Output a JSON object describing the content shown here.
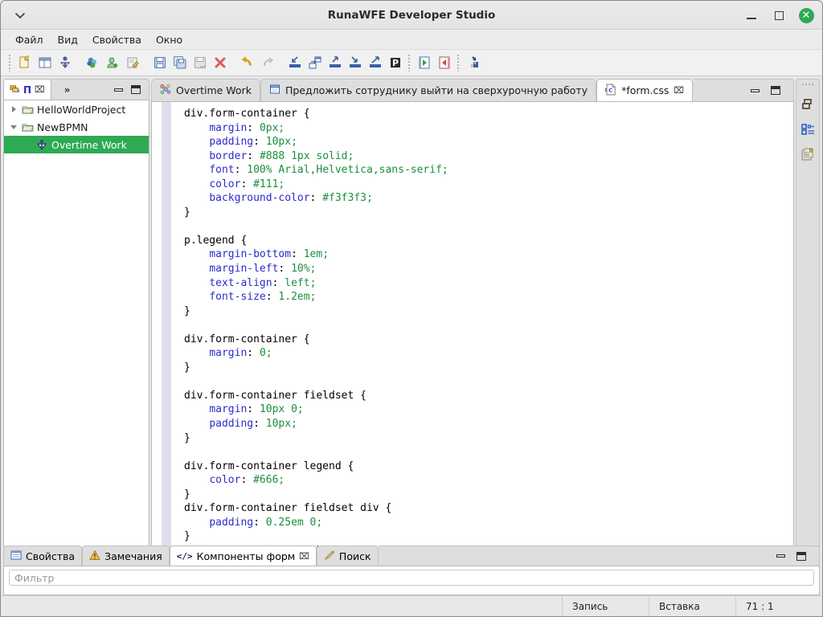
{
  "window": {
    "title": "RunaWFE Developer Studio",
    "chevron_icon": "chevron-down-icon",
    "minimize_label": "",
    "maximize_label": "",
    "close_label": "✕"
  },
  "menubar": {
    "items": [
      {
        "label": "Файл",
        "name": "menu-file"
      },
      {
        "label": "Вид",
        "name": "menu-view"
      },
      {
        "label": "Свойства",
        "name": "menu-properties"
      },
      {
        "label": "Окно",
        "name": "menu-window"
      }
    ]
  },
  "toolbar": {
    "buttons": [
      {
        "name": "new-file-icon"
      },
      {
        "name": "new-folder-icon"
      },
      {
        "name": "new-process-icon"
      },
      {
        "name": "group-icon"
      },
      {
        "name": "add-user-icon"
      },
      {
        "name": "edit-note-icon"
      },
      {
        "name": "save-icon"
      },
      {
        "name": "save-all-icon"
      },
      {
        "name": "save-as-icon"
      },
      {
        "name": "delete-icon"
      },
      {
        "name": "undo-icon"
      },
      {
        "name": "redo-icon"
      },
      {
        "name": "import-icon"
      },
      {
        "name": "deploy-icon"
      },
      {
        "name": "export-icon"
      },
      {
        "name": "export-par-icon"
      },
      {
        "name": "upload-icon"
      },
      {
        "name": "par-icon"
      },
      {
        "name": "back-icon"
      },
      {
        "name": "forward-icon"
      },
      {
        "name": "variables-icon"
      }
    ]
  },
  "left_panel": {
    "tab_label": "П",
    "tab_icon": "project-explorer-icon",
    "tab_close": "⌧",
    "overflow": "»",
    "minimize_tooltip": "",
    "maximize_tooltip": "",
    "tree": [
      {
        "label": "HelloWorldProject",
        "icon": "folder-icon",
        "state": "collapsed",
        "level": 0,
        "selected": false,
        "name": "tree-item-helloworldproject"
      },
      {
        "label": "NewBPMN",
        "icon": "folder-icon",
        "state": "expanded",
        "level": 0,
        "selected": false,
        "name": "tree-item-newbpmn"
      },
      {
        "label": "Overtime Work",
        "icon": "process-icon",
        "state": "leaf",
        "level": 1,
        "selected": true,
        "name": "tree-item-overtime-work"
      }
    ]
  },
  "editor": {
    "tabs": [
      {
        "label": "Overtime Work",
        "icon": "process-diagram-icon",
        "active": false,
        "closable": false,
        "name": "tab-overtime-work"
      },
      {
        "label": "Предложить сотруднику выйти на сверхурочную работу",
        "icon": "form-icon",
        "active": false,
        "closable": false,
        "name": "tab-form-editor"
      },
      {
        "label": "*form.css",
        "icon": "css-file-icon",
        "active": true,
        "closable": true,
        "close_glyph": "⌧",
        "name": "tab-form-css"
      }
    ],
    "code_lines": [
      [
        {
          "t": "div.form-container {",
          "c": "sel"
        }
      ],
      [
        {
          "t": "    ",
          "c": "punc"
        },
        {
          "t": "margin",
          "c": "prop"
        },
        {
          "t": ": ",
          "c": "punc"
        },
        {
          "t": "0px",
          "c": "val"
        },
        {
          "t": ";",
          "c": "val"
        }
      ],
      [
        {
          "t": "    ",
          "c": "punc"
        },
        {
          "t": "padding",
          "c": "prop"
        },
        {
          "t": ": ",
          "c": "punc"
        },
        {
          "t": "10px",
          "c": "val"
        },
        {
          "t": ";",
          "c": "val"
        }
      ],
      [
        {
          "t": "    ",
          "c": "punc"
        },
        {
          "t": "border",
          "c": "prop"
        },
        {
          "t": ": ",
          "c": "punc"
        },
        {
          "t": "#888 1px solid",
          "c": "val"
        },
        {
          "t": ";",
          "c": "val"
        }
      ],
      [
        {
          "t": "    ",
          "c": "punc"
        },
        {
          "t": "font",
          "c": "prop"
        },
        {
          "t": ": ",
          "c": "punc"
        },
        {
          "t": "100% Arial,Helvetica,sans-serif",
          "c": "val"
        },
        {
          "t": ";",
          "c": "val"
        }
      ],
      [
        {
          "t": "    ",
          "c": "punc"
        },
        {
          "t": "color",
          "c": "prop"
        },
        {
          "t": ": ",
          "c": "punc"
        },
        {
          "t": "#111",
          "c": "val"
        },
        {
          "t": ";",
          "c": "val"
        }
      ],
      [
        {
          "t": "    ",
          "c": "punc"
        },
        {
          "t": "background-color",
          "c": "prop"
        },
        {
          "t": ": ",
          "c": "punc"
        },
        {
          "t": "#f3f3f3",
          "c": "val"
        },
        {
          "t": ";",
          "c": "val"
        }
      ],
      [
        {
          "t": "}",
          "c": "sel"
        }
      ],
      [
        {
          "t": "",
          "c": "sel"
        }
      ],
      [
        {
          "t": "p.legend {",
          "c": "sel"
        }
      ],
      [
        {
          "t": "    ",
          "c": "punc"
        },
        {
          "t": "margin-bottom",
          "c": "prop"
        },
        {
          "t": ": ",
          "c": "punc"
        },
        {
          "t": "1em",
          "c": "val"
        },
        {
          "t": ";",
          "c": "val"
        }
      ],
      [
        {
          "t": "    ",
          "c": "punc"
        },
        {
          "t": "margin-left",
          "c": "prop"
        },
        {
          "t": ": ",
          "c": "punc"
        },
        {
          "t": "10%",
          "c": "val"
        },
        {
          "t": ";",
          "c": "val"
        }
      ],
      [
        {
          "t": "    ",
          "c": "punc"
        },
        {
          "t": "text-align",
          "c": "prop"
        },
        {
          "t": ": ",
          "c": "punc"
        },
        {
          "t": "left",
          "c": "val"
        },
        {
          "t": ";",
          "c": "val"
        }
      ],
      [
        {
          "t": "    ",
          "c": "punc"
        },
        {
          "t": "font-size",
          "c": "prop"
        },
        {
          "t": ": ",
          "c": "punc"
        },
        {
          "t": "1.2em",
          "c": "val"
        },
        {
          "t": ";",
          "c": "val"
        }
      ],
      [
        {
          "t": "}",
          "c": "sel"
        }
      ],
      [
        {
          "t": "",
          "c": "sel"
        }
      ],
      [
        {
          "t": "div.form-container {",
          "c": "sel"
        }
      ],
      [
        {
          "t": "    ",
          "c": "punc"
        },
        {
          "t": "margin",
          "c": "prop"
        },
        {
          "t": ": ",
          "c": "punc"
        },
        {
          "t": "0",
          "c": "val"
        },
        {
          "t": ";",
          "c": "val"
        }
      ],
      [
        {
          "t": "}",
          "c": "sel"
        }
      ],
      [
        {
          "t": "",
          "c": "sel"
        }
      ],
      [
        {
          "t": "div.form-container fieldset {",
          "c": "sel"
        }
      ],
      [
        {
          "t": "    ",
          "c": "punc"
        },
        {
          "t": "margin",
          "c": "prop"
        },
        {
          "t": ": ",
          "c": "punc"
        },
        {
          "t": "10px 0",
          "c": "val"
        },
        {
          "t": ";",
          "c": "val"
        }
      ],
      [
        {
          "t": "    ",
          "c": "punc"
        },
        {
          "t": "padding",
          "c": "prop"
        },
        {
          "t": ": ",
          "c": "punc"
        },
        {
          "t": "10px",
          "c": "val"
        },
        {
          "t": ";",
          "c": "val"
        }
      ],
      [
        {
          "t": "}",
          "c": "sel"
        }
      ],
      [
        {
          "t": "",
          "c": "sel"
        }
      ],
      [
        {
          "t": "div.form-container legend {",
          "c": "sel"
        }
      ],
      [
        {
          "t": "    ",
          "c": "punc"
        },
        {
          "t": "color",
          "c": "prop"
        },
        {
          "t": ": ",
          "c": "punc"
        },
        {
          "t": "#666",
          "c": "val"
        },
        {
          "t": ";",
          "c": "val"
        }
      ],
      [
        {
          "t": "}",
          "c": "sel"
        }
      ],
      [
        {
          "t": "div.form-container fieldset div {",
          "c": "sel"
        }
      ],
      [
        {
          "t": "    ",
          "c": "punc"
        },
        {
          "t": "padding",
          "c": "prop"
        },
        {
          "t": ": ",
          "c": "punc"
        },
        {
          "t": "0.25em 0",
          "c": "val"
        },
        {
          "t": ";",
          "c": "val"
        }
      ],
      [
        {
          "t": "}",
          "c": "sel"
        }
      ],
      [
        {
          "t": "div.form-container label {",
          "c": "sel"
        }
      ]
    ],
    "syntax_colors": {
      "selector": "#000000",
      "property": "#2b2bcc",
      "value": "#1a8f3c"
    }
  },
  "right_bar": {
    "icons": [
      {
        "name": "restore-perspective-icon"
      },
      {
        "name": "outline-view-icon"
      },
      {
        "name": "properties-view-icon"
      }
    ]
  },
  "bottom_panel": {
    "tabs": [
      {
        "label": "Свойства",
        "icon": "properties-icon",
        "active": false,
        "closable": false,
        "name": "tab-properties"
      },
      {
        "label": "Замечания",
        "icon": "warning-icon",
        "active": false,
        "closable": false,
        "name": "tab-problems"
      },
      {
        "label": "Компоненты форм",
        "icon": "code-brackets-icon",
        "active": true,
        "closable": true,
        "close_glyph": "⌧",
        "name": "tab-form-components"
      },
      {
        "label": "Поиск",
        "icon": "search-pencil-icon",
        "active": false,
        "closable": false,
        "name": "tab-search"
      }
    ],
    "filter_placeholder": "Фильтр",
    "filter_value": ""
  },
  "statusbar": {
    "left_text": "",
    "mode": "Запись",
    "insert": "Вставка",
    "position": "71 : 1"
  },
  "colors": {
    "selection_green": "#2eaa53",
    "window_bg": "#e8e8e8",
    "panel_bg": "#dedede",
    "editor_bg": "#ffffff",
    "annotation_ruler": "#dedeee"
  }
}
